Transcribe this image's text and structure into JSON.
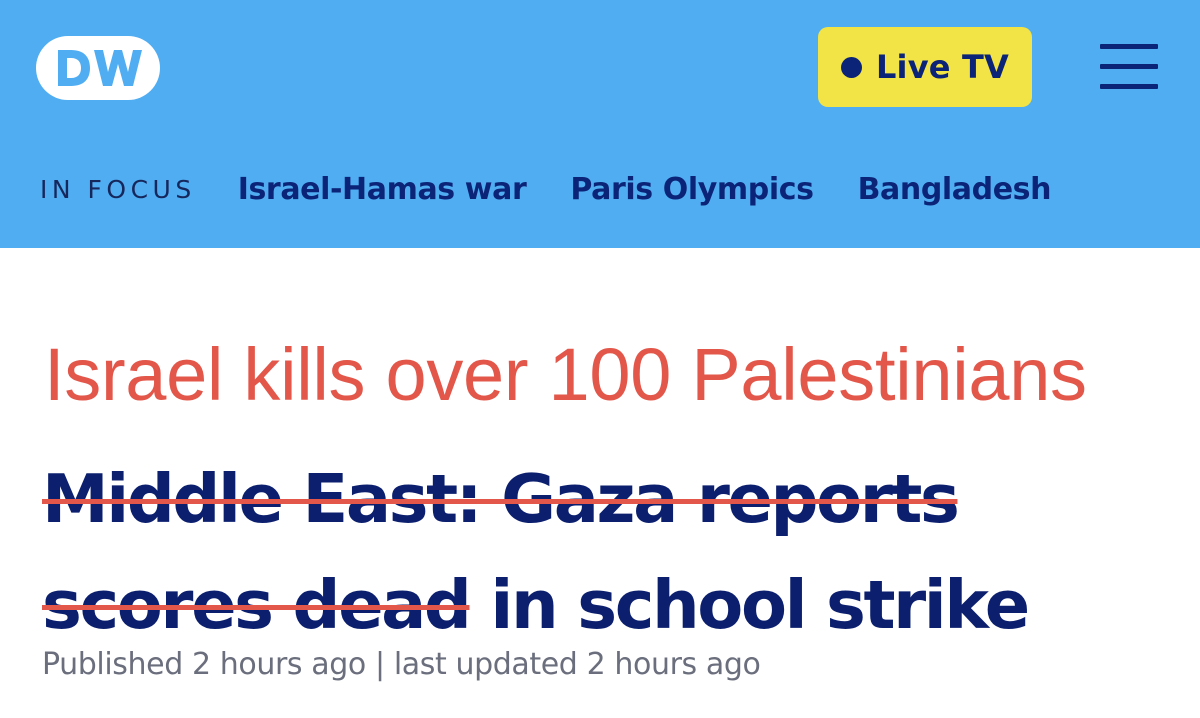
{
  "header": {
    "logo_text": "DW",
    "logo_icon": "dw-logo-icon",
    "live_tv": {
      "label": "Live TV",
      "dot_icon": "live-dot-icon"
    },
    "menu_icon": "hamburger-menu-icon"
  },
  "in_focus": {
    "label": "IN FOCUS",
    "links": [
      "Israel-Hamas war",
      "Paris Olympics",
      "Bangladesh"
    ]
  },
  "annotation": {
    "text": "Israel kills over 100 Palestinians"
  },
  "headline": {
    "struck_text": "Middle East: Gaza reports scores dead",
    "remaining_text": " in school strike"
  },
  "meta": {
    "published": "Published 2 hours ago | last updated 2 hours ago"
  },
  "colors": {
    "header_bg": "#50adf2",
    "navy": "#0b2477",
    "live_bg": "#f2e346",
    "annotation_red": "#e2574a",
    "meta_gray": "#6b6f7d"
  }
}
